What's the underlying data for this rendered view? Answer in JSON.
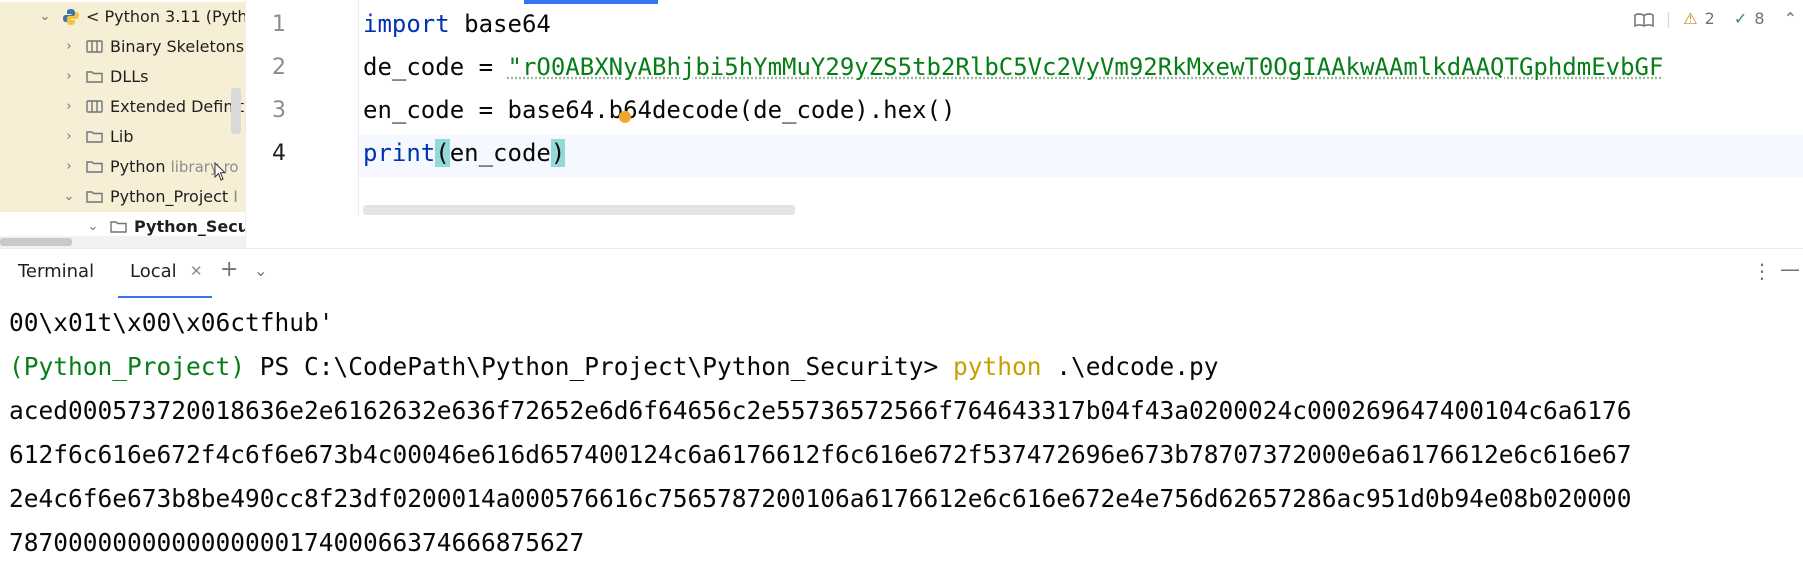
{
  "project_tree": {
    "root": "< Python 3.11 (Pyth",
    "items": [
      {
        "label": "Binary Skeletons",
        "hint": ""
      },
      {
        "label": "DLLs",
        "hint": ""
      },
      {
        "label": "Extended Definit",
        "hint": ""
      },
      {
        "label": "Lib",
        "hint": ""
      },
      {
        "label": "Python",
        "hint": "library ro"
      },
      {
        "label": "Python_Project",
        "hint": "I"
      },
      {
        "label": "Python_Secu",
        "hint": ""
      }
    ]
  },
  "editor": {
    "line_numbers": [
      "1",
      "2",
      "3",
      "4"
    ],
    "lines": {
      "l1_kw": "import",
      "l1_rest": " base64",
      "l2_prefix": "de_code = ",
      "l2_string": "\"rO0ABXNyABhjbi5hYmMuY29yZS5tb2RlbC5Vc2VyVm92RkMxewT0OgIAAkwAAmlkdAAQTGphdmEvbGF",
      "l3": "en_code = base64.b64decode(de_code).hex()",
      "l4_print": "print",
      "l4_open": "(",
      "l4_arg": "en_code",
      "l4_close": ")"
    },
    "inspections": {
      "warnings": "2",
      "ok": "8"
    }
  },
  "terminal": {
    "title": "Terminal",
    "tab": "Local",
    "lines": [
      "00\\x01t\\x00\\x06ctfhub'",
      "aced000573720018636e2e6162632e636f72652e6d6f64656c2e55736572566f764643317b04f43a0200024c000269647400104c6a6176",
      "612f6c616e672f4c6f6e673b4c00046e616d657400124c6a6176612f6c616e672f537472696e673b78707372000e6a6176612e6c616e67",
      "2e4c6f6e673b8be490cc8f23df0200014a000576616c7565787200106a6176612e6c616e672e4e756d62657286ac951d0b94e08b020000",
      "787000000000000000017400066374666875627"
    ],
    "prompt": {
      "venv": "(Python_Project)",
      "path": " PS C:\\CodePath\\Python_Project\\Python_Security> ",
      "cmd": "python",
      "args": " .\\edcode.py"
    }
  }
}
